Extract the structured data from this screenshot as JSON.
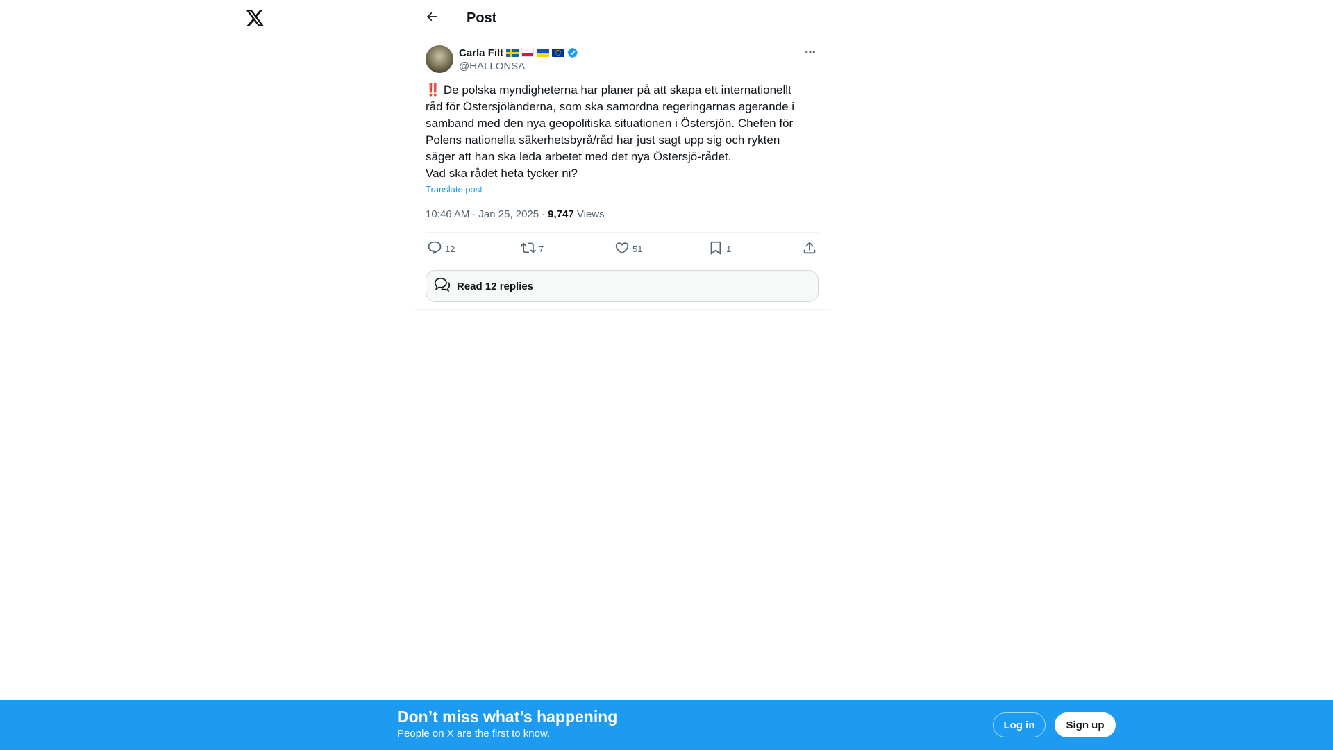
{
  "header": {
    "title": "Post"
  },
  "post": {
    "author": {
      "display_name": "Carla Filt",
      "handle": "@HALLONSA"
    },
    "alert_glyph": "‼️",
    "text": "De polska myndigheterna har planer på att skapa ett internationellt\nråd för Östersjöländerna, som ska samordna regeringarnas agerande i\nsamband med den nya geopolitiska situationen i Östersjön. Chefen för\nPolens nationella säkerhetsbyrå/råd har just sagt upp sig och rykten\nsäger att han ska leda arbetet med det nya Östersjö-rådet.\nVad ska rådet heta tycker ni?",
    "translate_label": "Translate post",
    "time": "10:46 AM",
    "date": "Jan 25, 2025",
    "views_count": "9,747",
    "views_label": "Views",
    "stats": {
      "replies": "12",
      "reposts": "7",
      "likes": "51",
      "bookmarks": "1"
    },
    "read_replies_label": "Read 12 replies"
  },
  "bottom_bar": {
    "title": "Don’t miss what’s happening",
    "subtitle": "People on X are the first to know.",
    "login_label": "Log in",
    "signup_label": "Sign up"
  },
  "colors": {
    "accent": "#1d9bf0",
    "text": "#0f1419",
    "secondary_text": "#536471"
  },
  "icons": [
    "x-logo-icon",
    "back-arrow-icon",
    "verified-badge-icon",
    "more-icon",
    "reply-icon",
    "repost-icon",
    "like-icon",
    "bookmark-icon",
    "share-icon",
    "speech-bubbles-icon"
  ]
}
